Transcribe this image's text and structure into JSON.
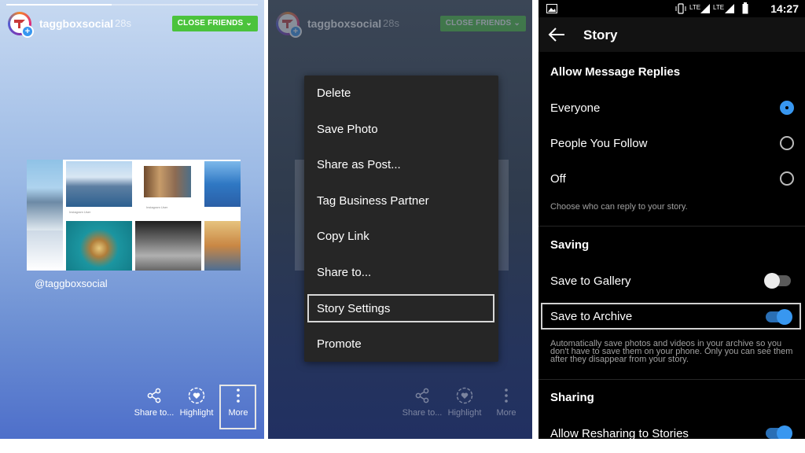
{
  "story": {
    "username": "taggboxsocial",
    "time": "28s",
    "close_friends_label": "CLOSE FRIENDS",
    "handle": "@taggboxsocial",
    "collage_caption": "Instagram User",
    "actions": [
      {
        "label": "Share to...",
        "icon": "share-icon"
      },
      {
        "label": "Highlight",
        "icon": "highlight-heart-icon"
      },
      {
        "label": "More",
        "icon": "more-vertical-icon"
      }
    ]
  },
  "menu": {
    "items": [
      "Delete",
      "Save Photo",
      "Share as Post...",
      "Tag Business Partner",
      "Copy Link",
      "Share to...",
      "Story Settings",
      "Promote"
    ],
    "highlighted": "Story Settings"
  },
  "settings": {
    "status_time": "14:27",
    "status_lte1": "LTE",
    "status_lte2": "LTE",
    "title": "Story",
    "replies": {
      "header": "Allow Message Replies",
      "options": [
        "Everyone",
        "People You Follow",
        "Off"
      ],
      "selected": "Everyone",
      "help": "Choose who can reply to your story."
    },
    "saving": {
      "header": "Saving",
      "gallery_label": "Save to Gallery",
      "gallery_on": false,
      "archive_label": "Save to Archive",
      "archive_on": true,
      "help": "Automatically save photos and videos in your archive so you don't have to save them on your phone. Only you can see them after they disappear from your story."
    },
    "sharing": {
      "header": "Sharing",
      "resharing_label": "Allow Resharing to Stories",
      "resharing_on": true
    }
  },
  "colors": {
    "close_friends_green": "#4bc33c",
    "toggle_blue": "#3897f0"
  }
}
